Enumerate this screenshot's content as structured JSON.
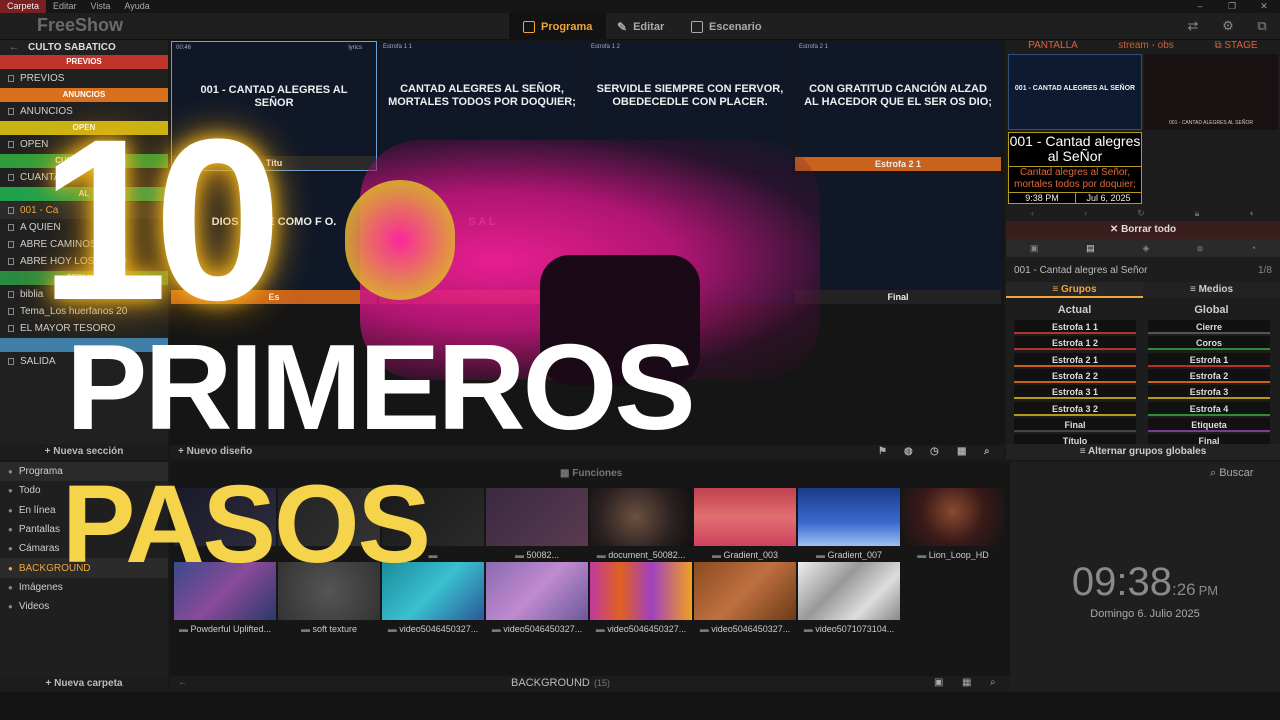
{
  "menu": {
    "items": [
      "Carpeta",
      "Editar",
      "Vista",
      "Ayuda"
    ]
  },
  "app": {
    "name": "FreeShow"
  },
  "tabs": {
    "program": "Programa",
    "edit": "Editar",
    "stage": "Escenario"
  },
  "project": {
    "title": "CULTO SABATICO",
    "footer": "Nueva sección",
    "entries": [
      {
        "type": "section",
        "label": "PREVIOS",
        "color": "#c0342b"
      },
      {
        "type": "item",
        "label": "PREVIOS"
      },
      {
        "type": "section",
        "label": "ANUNCIOS",
        "color": "#d9701e"
      },
      {
        "type": "item",
        "label": "ANUNCIOS"
      },
      {
        "type": "section",
        "label": "OPEN",
        "color": "#c9b414"
      },
      {
        "type": "item",
        "label": "OPEN"
      },
      {
        "type": "section",
        "label": "CUENTA REGR",
        "color": "#2f9e3a"
      },
      {
        "type": "item",
        "label": "CUANTA"
      },
      {
        "type": "section",
        "label": "AL",
        "color": "#21a04c"
      },
      {
        "type": "item",
        "label": "001 - Ca",
        "active": true
      },
      {
        "type": "item",
        "label": "A QUIEN"
      },
      {
        "type": "item",
        "label": "ABRE CAMINOS"
      },
      {
        "type": "item",
        "label": "ABRE HOY LOS CIELO"
      },
      {
        "type": "section",
        "label": "SERMON",
        "color": "#2a8a3e"
      },
      {
        "type": "item",
        "label": "biblia"
      },
      {
        "type": "item",
        "label": "Tema_Los huerfanos 20"
      },
      {
        "type": "item",
        "label": "EL MAYOR TESORO"
      },
      {
        "type": "section",
        "label": "",
        "color": "#3f7fa8"
      },
      {
        "type": "item",
        "label": "SALIDA"
      }
    ]
  },
  "slides": [
    {
      "label": "00:46",
      "extra": "lyrics",
      "text": "001 - CANTAD ALEGRES AL SEÑOR",
      "bar": "Títu",
      "bar_color": "#2a2a2a"
    },
    {
      "label": "Estrofa 1 1",
      "text": "CANTAD ALEGRES AL SEÑOR, MORTALES TODOS POR DOQUIER;",
      "bar": "",
      "bar_color": ""
    },
    {
      "label": "Estrofa 1 2",
      "text": "SERVIDLE SIEMPRE CON FERVOR, OBEDECEDLE CON PLACER.",
      "bar": "",
      "bar_color": ""
    },
    {
      "label": "Estrofa 2 1",
      "text": "CON GRATITUD CANCIÓN ALZAD AL HACEDOR QUE EL SER OS DIO;",
      "bar": "Estrofa 2 1",
      "bar_color": "#c8621c"
    },
    {
      "label": "",
      "text": "DIOS EXC E COMO F O.",
      "bar": "Es",
      "bar_color": "#c8621c"
    },
    {
      "label": "",
      "text": "S A L",
      "bar": "",
      "bar_color": "#c8621c"
    },
    {
      "label": "",
      "text": "",
      "bar": "",
      "bar_color": ""
    },
    {
      "label": "",
      "text": "",
      "bar": "Final",
      "bar_color": "#222"
    }
  ],
  "slides_footer": {
    "new_layout": "Nuevo diseño"
  },
  "output": {
    "tabs": [
      "PANTALLA",
      "stream - obs",
      "STAGE"
    ],
    "preview_title": "001 - CANTAD ALEGRES AL SEÑOR",
    "preview_title_small": "001 - CANTAD ALEGRES AL SEÑOR",
    "show_name": "001 - Cantad alegres al SeÑor",
    "next_text": "Cantad alegres al Señor, mortales todos por doquier;",
    "time": "9:38 PM",
    "date": "Jul 6, 2025",
    "clear_all": "Borrar todo",
    "current_show": "001 - Cantad alegres al Señor",
    "current_index": "1/8",
    "groups_tab": "Grupos",
    "media_tab": "Medios",
    "current_col": "Actual",
    "global_col": "Global",
    "current_groups": [
      {
        "name": "Estrofa 1 1",
        "color": "#b5332a"
      },
      {
        "name": "Estrofa 1 2",
        "color": "#b5332a"
      },
      {
        "name": "Estrofa 2 1",
        "color": "#c8621c"
      },
      {
        "name": "Estrofa 2 2",
        "color": "#c8621c"
      },
      {
        "name": "Estrofa 3 1",
        "color": "#b49a1a"
      },
      {
        "name": "Estrofa 3 2",
        "color": "#b49a1a"
      },
      {
        "name": "Final",
        "color": "#444"
      },
      {
        "name": "Título",
        "color": "#333"
      }
    ],
    "global_groups": [
      {
        "name": "Cierre",
        "color": "#555"
      },
      {
        "name": "Coros",
        "color": "#2f8a3a"
      },
      {
        "name": "Estrofa 1",
        "color": "#b5332a"
      },
      {
        "name": "Estrofa 2",
        "color": "#c8621c"
      },
      {
        "name": "Estrofa 3",
        "color": "#b49a1a"
      },
      {
        "name": "Estrofa 4",
        "color": "#2f8a3a"
      },
      {
        "name": "Etiqueta",
        "color": "#7a3a9a"
      },
      {
        "name": "Final",
        "color": "#444"
      }
    ],
    "toggle_global": "Alternar grupos globales"
  },
  "drawer": {
    "categories": [
      {
        "label": "Programa"
      },
      {
        "label": "Todo"
      },
      {
        "label": "En línea"
      },
      {
        "label": "Pantallas"
      },
      {
        "label": "Cámaras"
      },
      {
        "label": "BACKGROUND",
        "active": true
      },
      {
        "label": "Imágenes"
      },
      {
        "label": "Videos"
      }
    ],
    "new_folder": "Nueva carpeta",
    "func_tab": "Funciones",
    "folder_name": "BACKGROUND",
    "folder_count": "(15)",
    "search": "Buscar",
    "media_row1": [
      {
        "name": "",
        "g": "linear-gradient(135deg,#1a1a2a,#2c2c3c)"
      },
      {
        "name": "",
        "g": "linear-gradient(135deg,#222,#333)"
      },
      {
        "name": "",
        "g": "linear-gradient(135deg,#1a1a1a,#2a2a2a)"
      },
      {
        "name": "50082...",
        "g": "linear-gradient(135deg,#3a2a40,#5a3a50)"
      },
      {
        "name": "document_50082...",
        "g": "radial-gradient(circle at 45% 50%,#6a5040,#2a2020 60%,#111)"
      },
      {
        "name": "Gradient_003",
        "g": "linear-gradient(180deg,#c04050,#e07070 50%,#d04060)"
      },
      {
        "name": "Gradient_007",
        "g": "linear-gradient(180deg,#1a3a8a,#3a6ad0 60%,#a0c0f0)"
      },
      {
        "name": "Lion_Loop_HD",
        "g": "radial-gradient(circle at 50% 40%,#8a4a30,#3a1a18 50%,#141414)"
      }
    ],
    "media_row2": [
      {
        "name": "Powderful Uplifted...",
        "g": "linear-gradient(135deg,#3a4a8a,#8a4a9a 50%,#2a3a6a)"
      },
      {
        "name": "soft texture",
        "g": "radial-gradient(circle,#555,#333)"
      },
      {
        "name": "video5046450327...",
        "g": "linear-gradient(135deg,#1a8a9a,#3ac0d0 50%,#2a5a9a)"
      },
      {
        "name": "video5046450327...",
        "g": "linear-gradient(135deg,#8a6ab0,#c08ad0 50%,#6a5a9a)"
      },
      {
        "name": "video5046450327...",
        "g": "linear-gradient(90deg,#c03aa0,#e06020 30%,#a040c0 60%,#f0a020)"
      },
      {
        "name": "video5046450327...",
        "g": "linear-gradient(135deg,#8a4a20,#c07040 50%,#6a3a18)"
      },
      {
        "name": "video5071073104...",
        "g": "linear-gradient(135deg,#eee,#999 40%,#ddd 70%,#888)"
      }
    ]
  },
  "clock": {
    "time": "09:38",
    "seconds": ":26",
    "ampm": "PM",
    "date": "Domingo 6. Julio 2025"
  },
  "overlay": {
    "number": "10",
    "line1": "PRIMEROS",
    "line2": "PASOS"
  }
}
